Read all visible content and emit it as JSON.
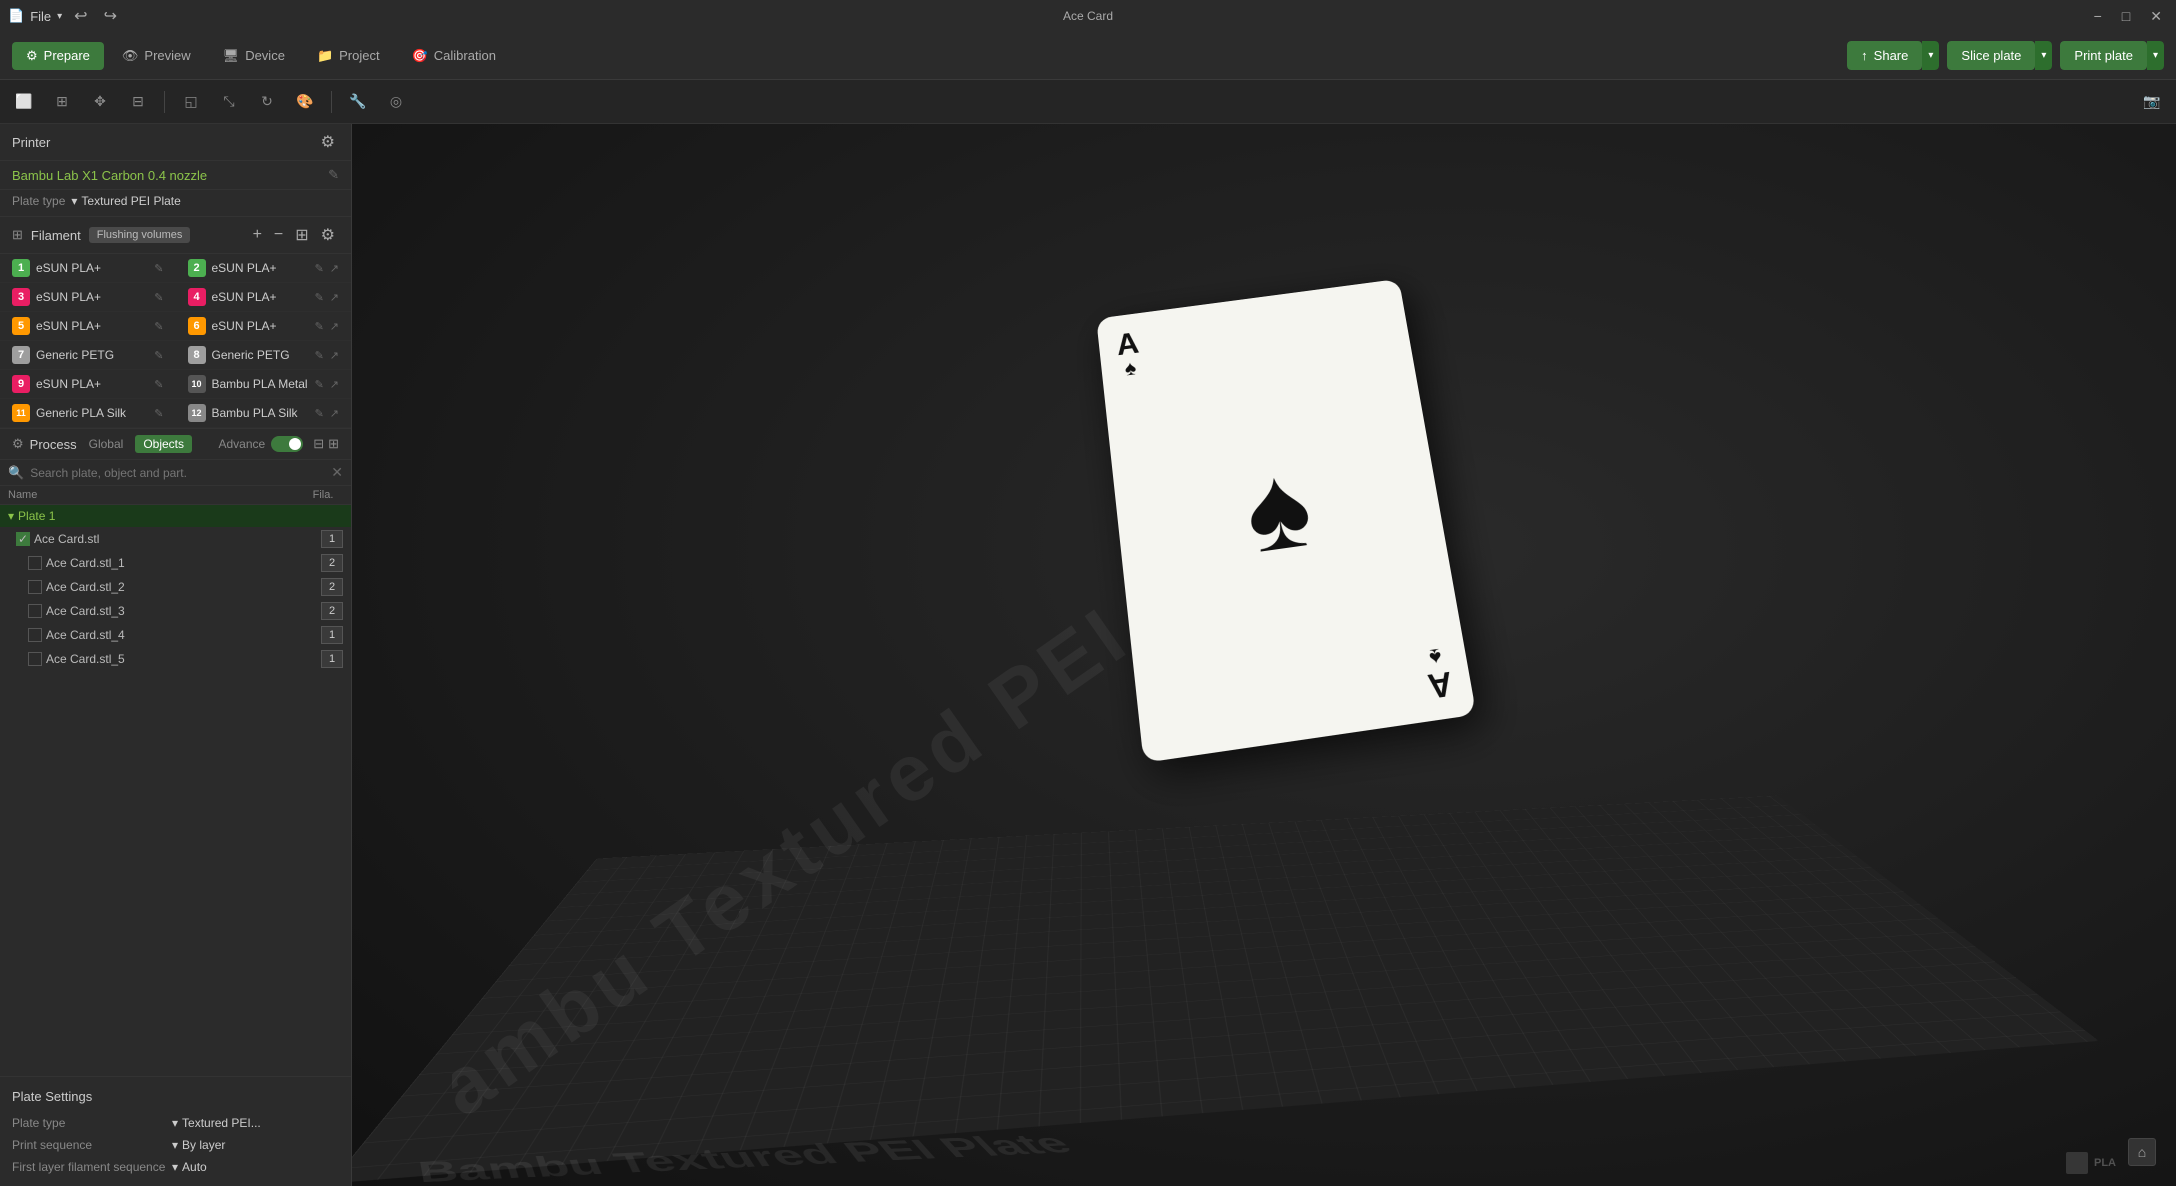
{
  "app": {
    "title": "Ace Card",
    "file_menu": "File"
  },
  "titlebar": {
    "min": "−",
    "max": "□",
    "close": "✕"
  },
  "tabs": [
    {
      "id": "prepare",
      "label": "Prepare",
      "active": true
    },
    {
      "id": "preview",
      "label": "Preview",
      "active": false
    },
    {
      "id": "device",
      "label": "Device",
      "active": false
    },
    {
      "id": "project",
      "label": "Project",
      "active": false
    },
    {
      "id": "calibration",
      "label": "Calibration",
      "active": false
    }
  ],
  "toolbar_right": {
    "share": "Share",
    "slice_plate": "Slice plate",
    "print_plate": "Print plate"
  },
  "printer_section": {
    "title": "Printer",
    "name": "Bambu Lab X1 Carbon 0.4 nozzle",
    "plate_label": "Plate type",
    "plate_value": "Textured PEI Plate"
  },
  "filament_section": {
    "title": "Filament",
    "flushing_label": "Flushing volumes",
    "items": [
      {
        "num": "1",
        "name": "eSUN PLA+",
        "color": "4caf50"
      },
      {
        "num": "2",
        "name": "eSUN PLA+",
        "color": "4caf50"
      },
      {
        "num": "3",
        "name": "eSUN PLA+",
        "color": "e91e63"
      },
      {
        "num": "4",
        "name": "eSUN PLA+",
        "color": "e91e63"
      },
      {
        "num": "5",
        "name": "eSUN PLA+",
        "color": "ff9800"
      },
      {
        "num": "6",
        "name": "eSUN PLA+",
        "color": "ff9800"
      },
      {
        "num": "7",
        "name": "Generic PETG",
        "color": "9e9e9e"
      },
      {
        "num": "8",
        "name": "Generic PETG",
        "color": "9e9e9e"
      },
      {
        "num": "9",
        "name": "eSUN PLA+",
        "color": "e91e63"
      },
      {
        "num": "10",
        "name": "Bambu PLA Metal",
        "color": "555555"
      },
      {
        "num": "11",
        "name": "Generic PLA Silk",
        "color": "ff9800"
      },
      {
        "num": "12",
        "name": "Bambu PLA Silk",
        "color": "888888"
      }
    ]
  },
  "process_section": {
    "title": "Process",
    "tab_global": "Global",
    "tab_objects": "Objects",
    "advance_label": "Advance"
  },
  "search": {
    "placeholder": "Search plate, object and part."
  },
  "object_list": {
    "col_name": "Name",
    "col_fila": "Fila.",
    "plate": "Plate 1",
    "items": [
      {
        "name": "Ace Card.stl",
        "level": 0,
        "fila": "1",
        "checked": true
      },
      {
        "name": "Ace Card.stl_1",
        "level": 1,
        "fila": "2",
        "checked": false
      },
      {
        "name": "Ace Card.stl_2",
        "level": 1,
        "fila": "2",
        "checked": false
      },
      {
        "name": "Ace Card.stl_3",
        "level": 1,
        "fila": "2",
        "checked": false
      },
      {
        "name": "Ace Card.stl_4",
        "level": 1,
        "fila": "1",
        "checked": false
      },
      {
        "name": "Ace Card.stl_5",
        "level": 1,
        "fila": "1",
        "checked": false
      }
    ]
  },
  "plate_settings": {
    "title": "Plate Settings",
    "plate_type_label": "Plate type",
    "plate_type_val": "Textured PEI...",
    "print_seq_label": "Print sequence",
    "print_seq_val": "By layer",
    "first_layer_label": "First layer filament sequence",
    "first_layer_val": "Auto"
  },
  "viewport": {
    "plate_text": "Bambu Textured PEI Plate"
  },
  "card": {
    "rank": "A",
    "suit": "♠"
  }
}
